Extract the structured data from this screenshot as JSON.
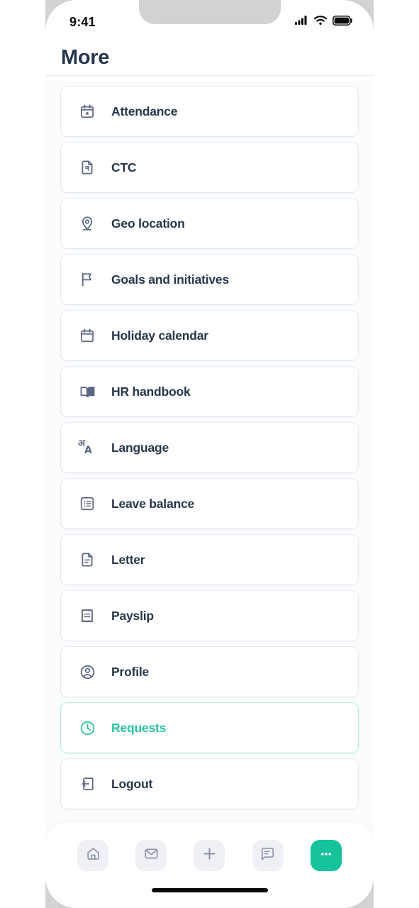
{
  "status_bar": {
    "time": "9:41",
    "icons": [
      "cellular-signal-icon",
      "wifi-icon",
      "battery-icon"
    ]
  },
  "header": {
    "title": "More"
  },
  "colors": {
    "accent": "#27c3a2",
    "nav_accent": "#14c39c",
    "text_primary": "#29354c",
    "title": "#27364f",
    "icon": "#5a6783",
    "card_bg": "#ffffff",
    "list_bg": "#fbfcfd",
    "nav_pill_bg": "#eef0f5"
  },
  "menu": {
    "items": [
      {
        "label": "Attendance",
        "icon": "calendar-event-icon",
        "active": false
      },
      {
        "label": "CTC",
        "icon": "rupee-document-icon",
        "active": false
      },
      {
        "label": "Geo location",
        "icon": "map-pin-icon",
        "active": false
      },
      {
        "label": "Goals and initiatives",
        "icon": "flag-icon",
        "active": false
      },
      {
        "label": "Holiday calendar",
        "icon": "calendar-icon",
        "active": false
      },
      {
        "label": "HR handbook",
        "icon": "open-book-icon",
        "active": false
      },
      {
        "label": "Language",
        "icon": "translate-icon",
        "active": false
      },
      {
        "label": "Leave balance",
        "icon": "list-box-icon",
        "active": false
      },
      {
        "label": "Letter",
        "icon": "document-icon",
        "active": false
      },
      {
        "label": "Payslip",
        "icon": "receipt-icon",
        "active": false
      },
      {
        "label": "Profile",
        "icon": "user-circle-icon",
        "active": false
      },
      {
        "label": "Requests",
        "icon": "clock-icon",
        "active": true
      },
      {
        "label": "Logout",
        "icon": "logout-icon",
        "active": false
      }
    ],
    "language_glyphs": {
      "devanagari": "अ",
      "latin": "A"
    }
  },
  "bottom_nav": {
    "items": [
      {
        "name": "home",
        "icon": "home-icon",
        "active": false
      },
      {
        "name": "mail",
        "icon": "mail-icon",
        "active": false
      },
      {
        "name": "add",
        "icon": "plus-icon",
        "active": false
      },
      {
        "name": "chat",
        "icon": "chat-icon",
        "active": false
      },
      {
        "name": "more",
        "icon": "ellipsis-icon",
        "active": true
      }
    ]
  }
}
